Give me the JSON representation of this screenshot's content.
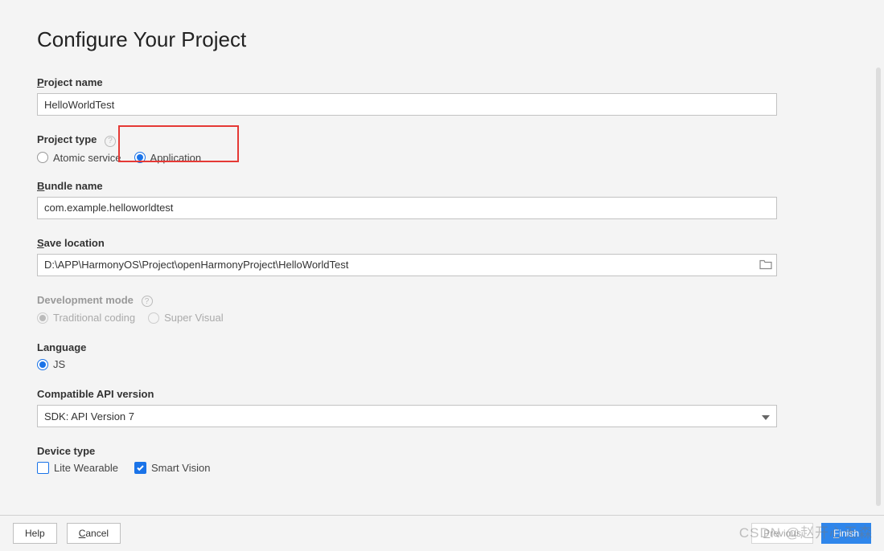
{
  "title": "Configure Your Project",
  "fields": {
    "projectName": {
      "label": "Project name",
      "underline": "P",
      "value": "HelloWorldTest"
    },
    "projectType": {
      "label": "Project type",
      "options": {
        "atomic": "Atomic service",
        "application": "Application"
      },
      "selected": "application"
    },
    "bundleName": {
      "label": "Bundle name",
      "underline": "B",
      "value": "com.example.helloworldtest"
    },
    "saveLocation": {
      "label": "Save location",
      "underline": "S",
      "value": "D:\\APP\\HarmonyOS\\Project\\openHarmonyProject\\HelloWorldTest"
    },
    "devMode": {
      "label": "Development mode",
      "options": {
        "traditional": "Traditional coding",
        "superVisual": "Super Visual"
      },
      "selected": "traditional",
      "disabled": true
    },
    "language": {
      "label": "Language",
      "options": {
        "js": "JS"
      },
      "selected": "js"
    },
    "apiVersion": {
      "label": "Compatible API version",
      "value": "SDK: API Version 7"
    },
    "deviceType": {
      "label": "Device type",
      "options": {
        "liteWearable": "Lite Wearable",
        "smartVision": "Smart Vision"
      },
      "checked": [
        "smartVision"
      ]
    }
  },
  "footer": {
    "help": "Help",
    "cancel": "Cancel",
    "cancelUnder": "C",
    "previous": "Previous",
    "previousUnder": "P",
    "finish": "Finish",
    "finishUnder": "F"
  },
  "watermark": "CSDN @赵开心无森"
}
